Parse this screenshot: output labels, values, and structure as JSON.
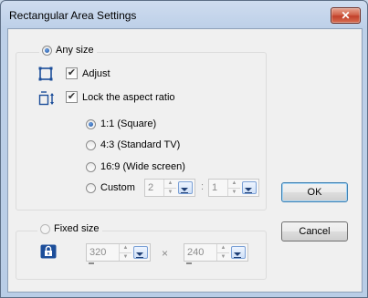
{
  "window": {
    "title": "Rectangular Area Settings",
    "close_glyph": "✕"
  },
  "any_size": {
    "label": "Any size",
    "selected": true,
    "adjust": {
      "label": "Adjust",
      "checked": true,
      "icon": "crop-rectangle-icon"
    },
    "lock_aspect": {
      "label": "Lock the aspect ratio",
      "checked": true,
      "icon": "aspect-ratio-icon"
    },
    "ratios": [
      {
        "label": "1:1 (Square)",
        "selected": true
      },
      {
        "label": "4:3 (Standard TV)",
        "selected": false
      },
      {
        "label": "16:9 (Wide screen)",
        "selected": false
      },
      {
        "label": "Custom",
        "selected": false
      }
    ],
    "custom": {
      "left_value": "2",
      "separator": ":",
      "right_value": "1"
    }
  },
  "fixed_size": {
    "label": "Fixed size",
    "selected": false,
    "lock_icon": "lock-icon",
    "width_value": "320",
    "separator": "×",
    "height_value": "240"
  },
  "buttons": {
    "ok": "OK",
    "cancel": "Cancel"
  },
  "colors": {
    "accent": "#1c4e9a",
    "close": "#c2402a"
  }
}
